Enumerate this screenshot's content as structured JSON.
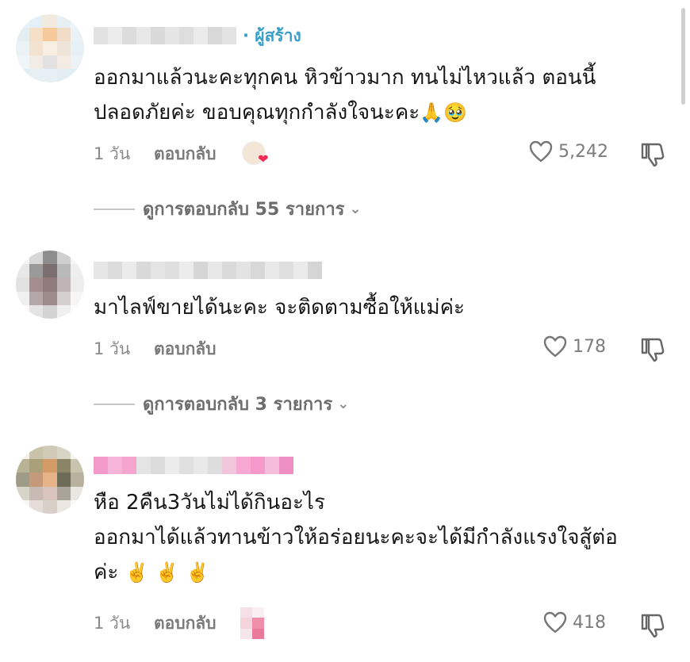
{
  "comments": [
    {
      "creator_badge": "· ผู้สร้าง",
      "lines": [
        "ออกมาแล้วนะคะทุกคน หิวข้าวมาก ทนไม่ไหวแล้ว ตอนนี้",
        "ปลอดภัยค่ะ ขอบคุณทุกกำลังใจนะคะ"
      ],
      "emojis": [
        "🙏",
        "🥹"
      ],
      "time": "1 วัน",
      "reply_label": "ตอบกลับ",
      "likes": "5,242",
      "view_replies": "ดูการตอบกลับ 55 รายการ"
    },
    {
      "lines": [
        "มาไลฟ์ขายได้นะคะ จะติดตามซื้อให้แม่ค่ะ"
      ],
      "time": "1 วัน",
      "reply_label": "ตอบกลับ",
      "likes": "178",
      "view_replies": "ดูการตอบกลับ 3 รายการ"
    },
    {
      "lines": [
        "หือ 2คืน3วันไม่ได้กินอะไร",
        "ออกมาได้แล้วทานข้าวให้อร่อยนะคะจะได้มีกำลังแรงใจสู้ต่อ",
        "ค่ะ"
      ],
      "emojis": [
        "✌️",
        "✌️",
        "✌️"
      ],
      "time": "1 วัน",
      "reply_label": "ตอบกลับ",
      "likes": "418"
    }
  ],
  "icons": {
    "like": "heart-outline-icon",
    "dislike": "thumbs-down-outline-icon",
    "chevron": "chevron-down-icon"
  },
  "colors": {
    "creator_badge": "#3a9fc7",
    "heart_badge": "#ee2c55",
    "meta_text": "#8a8a8a"
  }
}
